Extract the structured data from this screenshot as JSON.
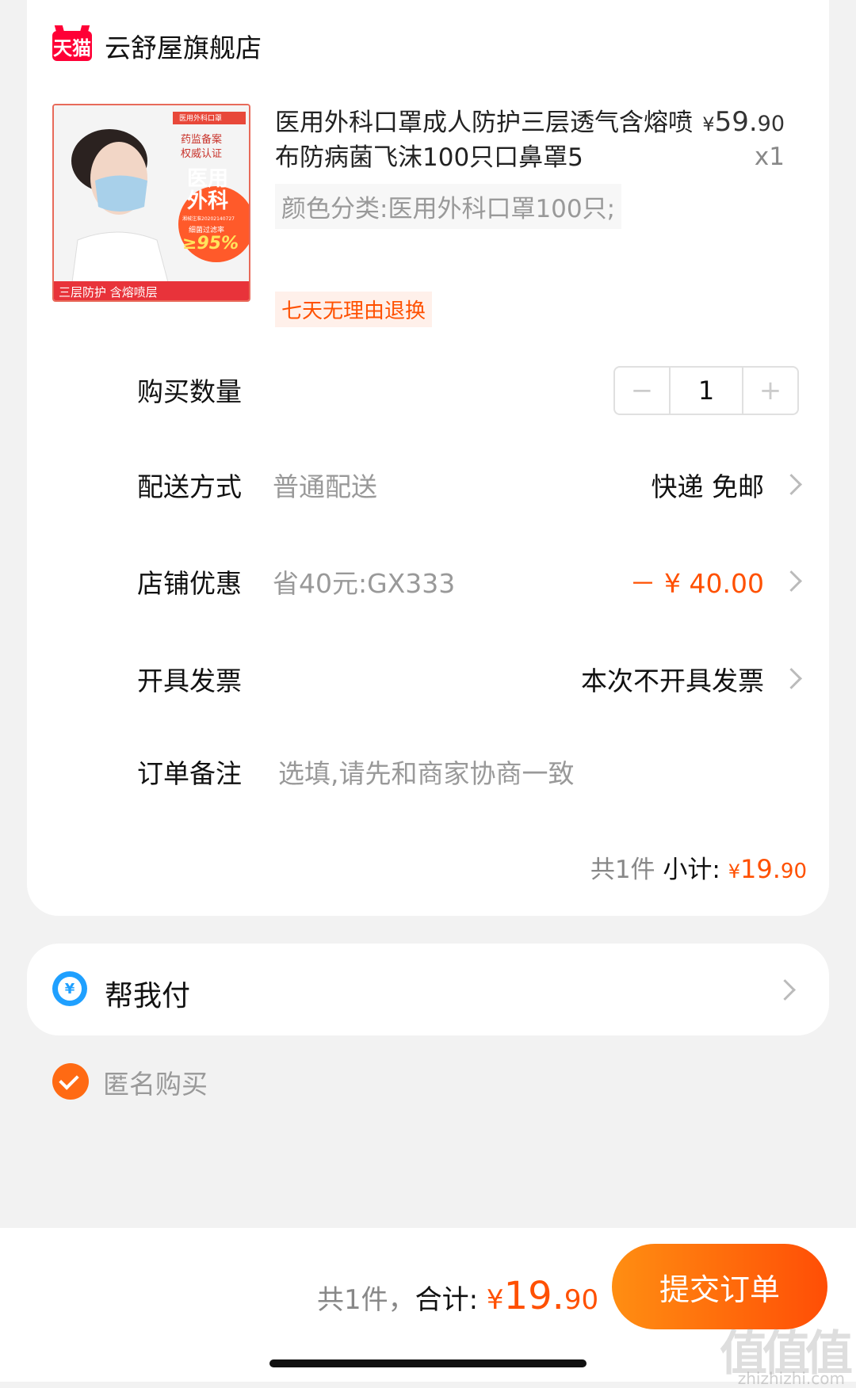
{
  "store": {
    "logo_text": "天猫",
    "name": "云舒屋旗舰店"
  },
  "product": {
    "image_texts": {
      "badge_top": "医用外科口罩",
      "cert_line1": "药监备案",
      "cert_line2": "权威认证",
      "big_1": "医用",
      "big_2": "外科",
      "reg_no": "湘械注准20202140727",
      "filter_label": "细菌过滤率",
      "filter_value": "≥95%",
      "bottom_banner": "三层防护 含熔喷层"
    },
    "title": "医用外科口罩成人防护三层透气含熔喷布防病菌飞沫100只口鼻罩5",
    "price_yen": "¥",
    "price_int": "59.",
    "price_cents": "90",
    "quantity_label": "x1",
    "sku": "颜色分类:医用外科口罩100只;",
    "return_tag": "七天无理由退换"
  },
  "quantity": {
    "label": "购买数量",
    "minus": "−",
    "value": "1",
    "plus": "+"
  },
  "delivery": {
    "label": "配送方式",
    "value": "普通配送",
    "right": "快递 免邮"
  },
  "store_discount": {
    "label": "店铺优惠",
    "value": "省40元:GX333",
    "right": "－ ¥ 40.00"
  },
  "invoice": {
    "label": "开具发票",
    "right": "本次不开具发票"
  },
  "note": {
    "label": "订单备注",
    "placeholder": "选填,请先和商家协商一致"
  },
  "subtotal": {
    "count": "共1件",
    "label": "小计:",
    "yen": "¥",
    "int": "19.",
    "cents": "90"
  },
  "help_pay": {
    "icon": "¥",
    "label": "帮我付"
  },
  "anonymous": {
    "label": "匿名购买",
    "checked": true
  },
  "bottom": {
    "count": "共1件，",
    "label": "合计:",
    "yen": "¥",
    "int": "19.",
    "cents": "90",
    "submit": "提交订单",
    "watermark": "值值值",
    "watermark_sub": "zhizhizhi.com"
  },
  "colors": {
    "accent": "#ff5000",
    "submit_start": "#ff8e12",
    "submit_end": "#ff4e06",
    "tmall_red": "#ff0036"
  }
}
